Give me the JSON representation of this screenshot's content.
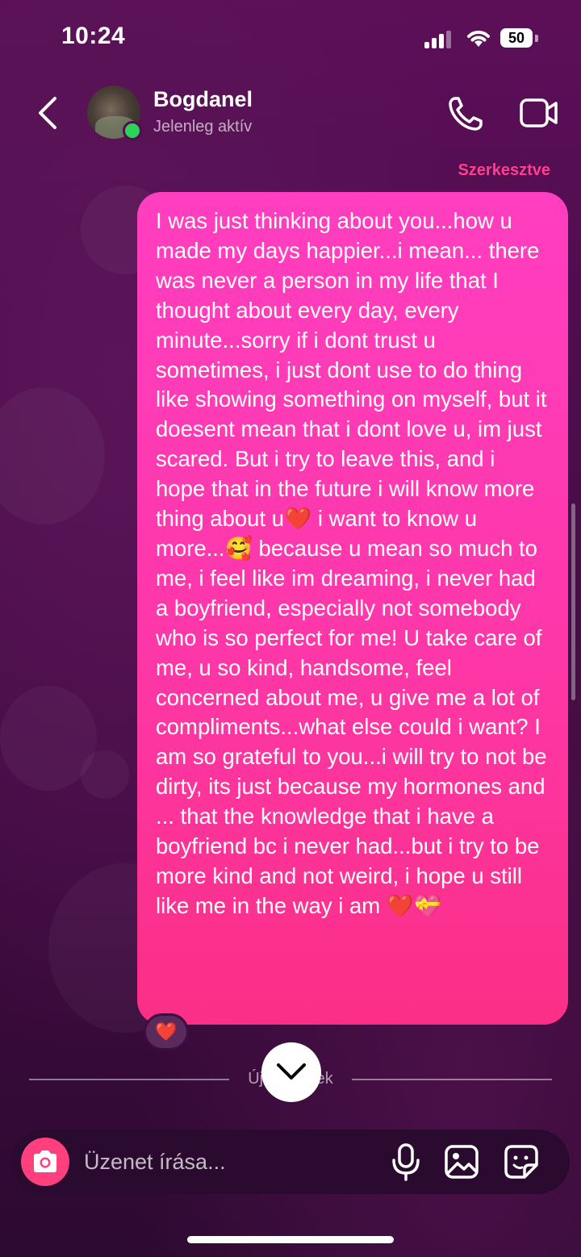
{
  "status_bar": {
    "time": "10:24",
    "battery": "50"
  },
  "header": {
    "name": "Bogdanel",
    "status": "Jelenleg aktív"
  },
  "message": {
    "edited_label": "Szerkesztve",
    "text": "I was just thinking about you...how u made my days happier...i mean... there was never a person in my life that I thought about every day, every minute...sorry if i dont trust u sometimes, i just dont use to do thing like showing something on myself, but it doesent mean that i dont love u, im just scared. But i try to leave this, and i hope that in the future i will know more thing about u❤️ i want to know u more...🥰 because u mean so much to me, i feel like im dreaming, i never had a boyfriend, especially not somebody who is so perfect for me! U take care of me, u so kind, handsome, feel concerned about me, u give me a lot of compliments...what else could i want? I am so grateful to you...i will try to not be dirty, its just because my hormones and ... that the knowledge that i have a boyfriend bc i never had...but i try to be more kind and not weird, i hope u still like me in the way i am ❤️💝",
    "reaction": "❤️"
  },
  "divider": {
    "label": "Új üzenetek"
  },
  "composer": {
    "placeholder": "Üzenet írása..."
  },
  "colors": {
    "bubble": "#fe37a8",
    "accent": "#ff3f8e",
    "camera": "#ff3f7e",
    "online": "#2ed15a"
  },
  "icons": [
    "back-chevron-icon",
    "phone-icon",
    "video-camera-icon",
    "chevron-down-icon",
    "camera-icon",
    "microphone-icon",
    "gallery-icon",
    "sticker-icon"
  ]
}
